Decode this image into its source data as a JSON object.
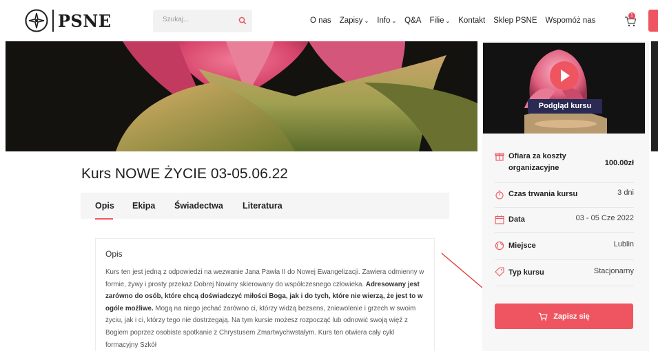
{
  "header": {
    "logo_text": "PSNE",
    "search_placeholder": "Szukaj...",
    "nav": [
      {
        "label": "O nas",
        "dropdown": false
      },
      {
        "label": "Zapisy",
        "dropdown": true
      },
      {
        "label": "Info",
        "dropdown": true
      },
      {
        "label": "Q&A",
        "dropdown": false
      },
      {
        "label": "Filie",
        "dropdown": true
      },
      {
        "label": "Kontakt",
        "dropdown": false
      },
      {
        "label": "Sklep PSNE",
        "dropdown": false
      },
      {
        "label": "Wspomóż nas",
        "dropdown": false
      }
    ],
    "cart_count": "1",
    "icons": {
      "search": "search-icon",
      "cart": "cart-icon",
      "dropdown": "chevron-down-icon"
    }
  },
  "course": {
    "title": "Kurs NOWE ŻYCIE 03-05.06.22",
    "tabs": [
      "Opis",
      "Ekipa",
      "Świadectwa",
      "Literatura"
    ],
    "active_tab": "Opis"
  },
  "description": {
    "heading": "Opis",
    "p1": "Kurs ten jest jedną z odpowiedzi na wezwanie Jana Pawła II do Nowej Ewangelizacji. Zawiera odmienny w formie, żywy i prosty przekaz Dobrej Nowiny skierowany do współczesnego człowieka. ",
    "p1_bold": "Adresowany jest zarówno do osób, które chcą doświadczyć miłości Boga, jak i do tych, które nie wierzą, że jest to w ogóle możliwe.",
    "p1_rest": " Mogą na niego jechać zarówno ci, którzy widzą bezsens, zniewolenie i grzech w swoim życiu, jak i ci, którzy tego nie dostrzegają. Na tym kursie możesz rozpocząć lub odnowić swoją więź z Bogiem poprzez osobiste spotkanie z Chrystusem Zmartwychwstałym. Kurs ten otwiera cały cykl formacyjny Szkół"
  },
  "sidebar": {
    "preview_label": "Podgląd kursu",
    "info": [
      {
        "icon": "gift-icon",
        "label": "Ofiara za koszty organizacyjne",
        "value": "100.00zł"
      },
      {
        "icon": "stopwatch-icon",
        "label": "Czas trwania kursu",
        "value": "3 dni"
      },
      {
        "icon": "calendar-icon",
        "label": "Data",
        "value": "03 - 05 Cze 2022"
      },
      {
        "icon": "globe-icon",
        "label": "Miejsce",
        "value": "Lublin"
      },
      {
        "icon": "tag-icon",
        "label": "Typ kursu",
        "value": "Stacjonarny"
      }
    ],
    "enroll_label": "Zapisz się"
  },
  "colors": {
    "accent": "#ef5560",
    "preview_bg": "#2a2a55"
  }
}
